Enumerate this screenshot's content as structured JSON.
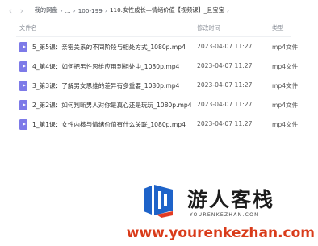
{
  "breadcrumb": {
    "items": [
      "我的网盘",
      "...",
      "100-199",
      "110.女性成长—情绪价值【视频课】_且宝宝"
    ]
  },
  "columns": {
    "name": "文件名",
    "date": "修改时间",
    "type": "类型"
  },
  "files": [
    {
      "name": "5_第5课：亲密关系的不同阶段与相处方式_1080p.mp4",
      "date": "2023-04-07 11:27",
      "type": "mp4文件"
    },
    {
      "name": "4_第4课：如何把男性思维应用到相处中_1080p.mp4",
      "date": "2023-04-07 11:27",
      "type": "mp4文件"
    },
    {
      "name": "3_第3课：了解男女思维的差异有多重要_1080p.mp4",
      "date": "2023-04-07 11:27",
      "type": "mp4文件"
    },
    {
      "name": "2_第2课：如何判断男人对你是真心还是玩玩_1080p.mp4",
      "date": "2023-04-07 11:27",
      "type": "mp4文件"
    },
    {
      "name": "1_第1课：女性内核与情绪价值有什么关联_1080p.mp4",
      "date": "2023-04-07 11:27",
      "type": "mp4文件"
    }
  ],
  "watermark": {
    "title": "游人客栈",
    "subtitle": "YOURENKEZHAN.COM",
    "url": "www.yourenkezhan.com",
    "colors": {
      "logo_blue": "#1e63c9",
      "url_red": "#d93b1a"
    }
  },
  "icons": {
    "back": "chevron-left-icon",
    "forward": "chevron-right-icon",
    "file": "video-file-icon"
  },
  "colors": {
    "file_icon": "#7d7ae8"
  }
}
